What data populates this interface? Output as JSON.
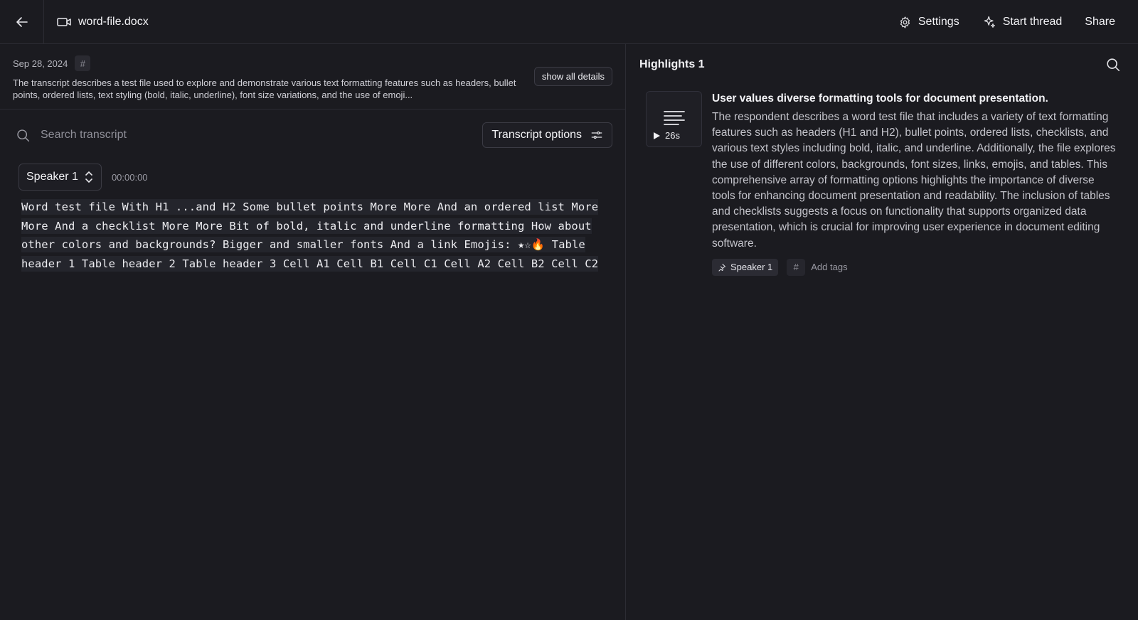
{
  "header": {
    "file_name": "word-file.docx",
    "actions": {
      "settings": "Settings",
      "start_thread": "Start thread",
      "share": "Share"
    }
  },
  "meta": {
    "date": "Sep 28, 2024",
    "hash_symbol": "#",
    "summary": "The transcript describes a test file used to explore and demonstrate various text formatting features such as headers, bullet points, ordered lists, text styling (bold, italic, underline), font size variations, and the use of emoji...",
    "show_details_label": "show all details"
  },
  "search": {
    "placeholder": "Search transcript",
    "options_label": "Transcript options"
  },
  "transcript": {
    "speaker": "Speaker 1",
    "timestamp": "00:00:00",
    "text": "Word test file With H1 ...and H2 Some bullet points More More And an ordered list More More And a checklist More More Bit of bold, italic and underline formatting How about other colors and backgrounds? Bigger and smaller fonts And a link Emojis: ★☆🔥 Table header 1 Table header 2 Table header 3 Cell A1 Cell B1 Cell C1 Cell A2 Cell B2 Cell C2"
  },
  "highlights": {
    "title": "Highlights 1",
    "items": [
      {
        "duration": "26s",
        "title": "User values diverse formatting tools for document presentation.",
        "text": "The respondent describes a word test file that includes a variety of text formatting features such as headers (H1 and H2), bullet points, ordered lists, checklists, and various text styles including bold, italic, and underline. Additionally, the file explores the use of different colors, backgrounds, font sizes, links, emojis, and tables. This comprehensive array of formatting options highlights the importance of diverse tools for enhancing document presentation and readability. The inclusion of tables and checklists suggests a focus on functionality that supports organized data presentation, which is crucial for improving user experience in document editing software.",
        "speaker_tag": "Speaker 1",
        "add_tags_label": "Add tags"
      }
    ]
  },
  "icons": {
    "back": "arrow-left-icon",
    "file": "video-icon",
    "settings": "gear-icon",
    "thread": "sparkle-icon",
    "search": "search-icon",
    "options": "sliders-icon",
    "speaker_select": "chevron-updown-icon",
    "thumb": "text-lines-icon",
    "play": "play-icon",
    "tag": "pin-icon",
    "hash": "hash-icon"
  }
}
